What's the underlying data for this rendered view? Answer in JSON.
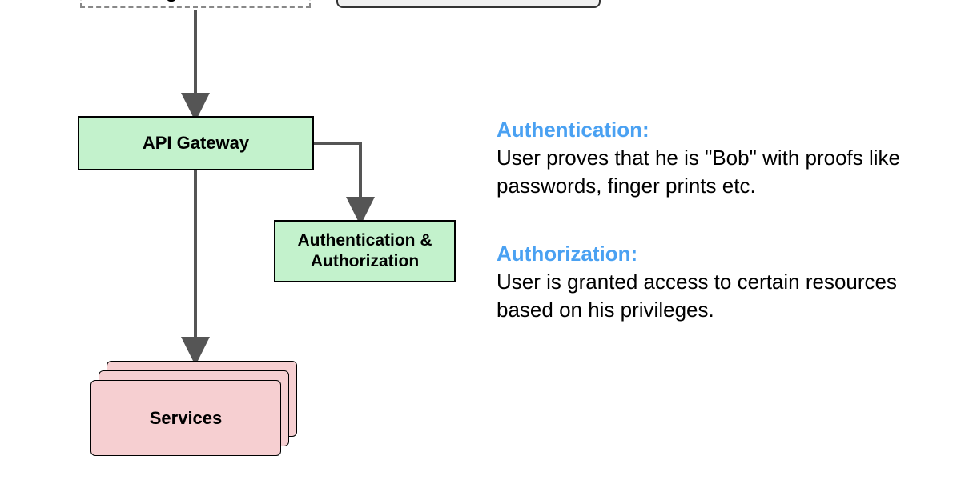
{
  "nodes": {
    "api_gateway": "API Gateway",
    "auth_box_line1": "Authentication &",
    "auth_box_line2": "Authorization",
    "services": "Services"
  },
  "annotations": {
    "authn_term": "Authentication",
    "authn_body": "User proves that he is \"Bob\" with proofs like passwords, finger prints etc.",
    "authz_term": "Authorization",
    "authz_body": "User is granted access to certain resources based on his privileges."
  },
  "colors": {
    "green": "#c3f2cc",
    "pink": "#f6cfd1",
    "term_blue": "#4aa1f2",
    "arrow": "#555555"
  },
  "chart_data": {
    "type": "diagram",
    "nodes": [
      {
        "id": "client_top",
        "label": "",
        "style": "dashed",
        "note": "partially cropped at top"
      },
      {
        "id": "top_right",
        "label": "",
        "style": "gray-rounded",
        "note": "partially cropped at top"
      },
      {
        "id": "api_gateway",
        "label": "API Gateway",
        "style": "green-rect"
      },
      {
        "id": "auth",
        "label": "Authentication & Authorization",
        "style": "green-rect"
      },
      {
        "id": "services",
        "label": "Services",
        "style": "pink-stack",
        "stack_count": 3
      }
    ],
    "edges": [
      {
        "from": "client_top",
        "to": "api_gateway",
        "dir": "down"
      },
      {
        "from": "api_gateway",
        "to": "auth",
        "dir": "right-then-down"
      },
      {
        "from": "api_gateway",
        "to": "services",
        "dir": "down"
      }
    ],
    "annotations": [
      {
        "term": "Authentication",
        "definition": "User proves that he is \"Bob\" with proofs like passwords, finger prints etc."
      },
      {
        "term": "Authorization",
        "definition": "User is granted access to certain resources based on his privileges."
      }
    ]
  }
}
